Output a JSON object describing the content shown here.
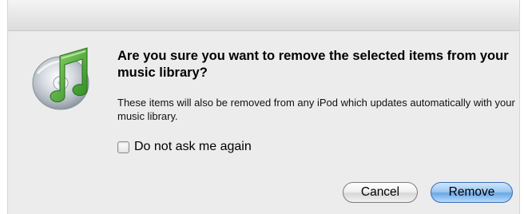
{
  "dialog": {
    "icon": "itunes-icon",
    "headline": "Are you sure you want to remove the selected items from your music library?",
    "info": "These items will also be removed from any iPod which updates automatically with your music library.",
    "checkbox": {
      "label": "Do not ask me again",
      "checked": false
    },
    "buttons": {
      "cancel": "Cancel",
      "remove": "Remove"
    },
    "colors": {
      "accent": "#6aa8e6",
      "note": "#3c9a2c"
    }
  }
}
